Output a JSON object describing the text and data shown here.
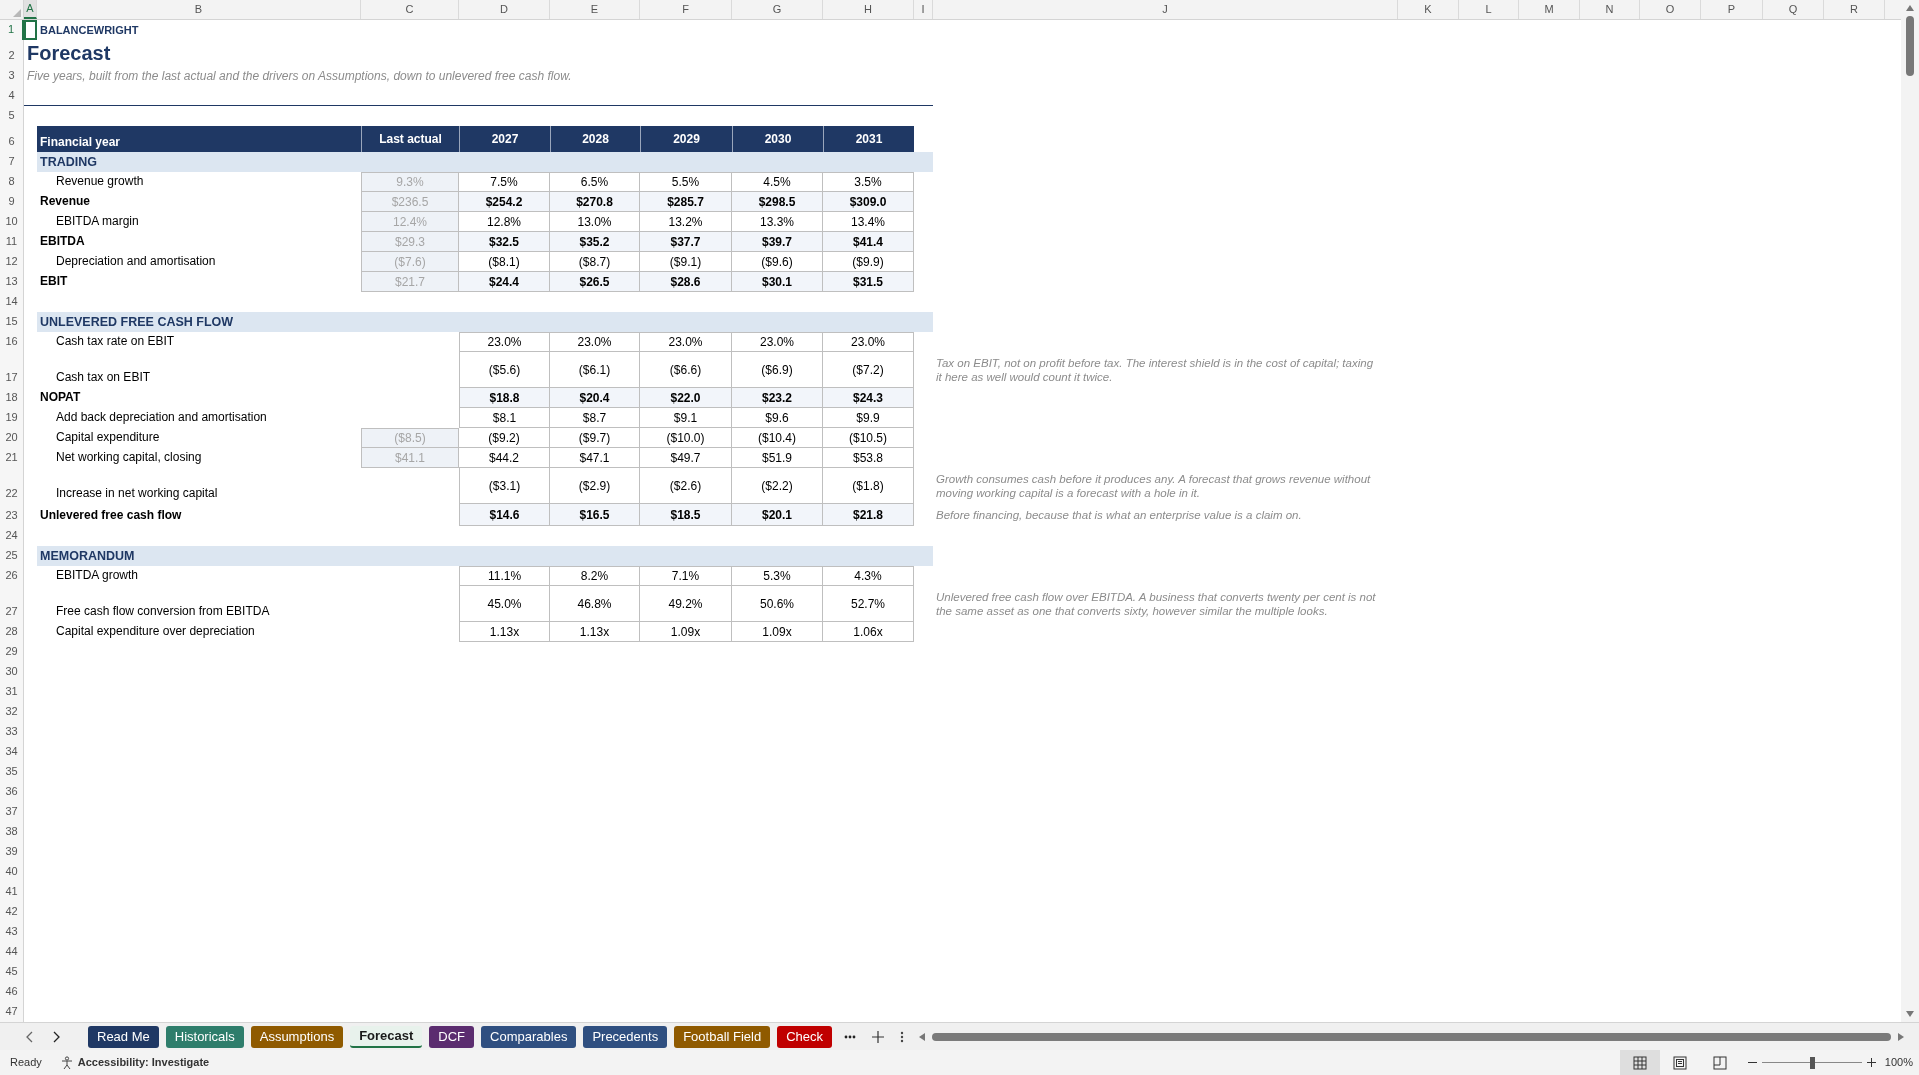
{
  "column_headers": [
    {
      "label": "A",
      "selected": true
    },
    {
      "label": "B",
      "selected": false
    },
    {
      "label": "C",
      "selected": false
    },
    {
      "label": "D",
      "selected": false
    },
    {
      "label": "E",
      "selected": false
    },
    {
      "label": "F",
      "selected": false
    },
    {
      "label": "G",
      "selected": false
    },
    {
      "label": "H",
      "selected": false
    },
    {
      "label": "I",
      "selected": false
    },
    {
      "label": "J",
      "selected": false
    },
    {
      "label": "K",
      "selected": false
    },
    {
      "label": "L",
      "selected": false
    },
    {
      "label": "M",
      "selected": false
    },
    {
      "label": "N",
      "selected": false
    },
    {
      "label": "O",
      "selected": false
    },
    {
      "label": "P",
      "selected": false
    },
    {
      "label": "Q",
      "selected": false
    },
    {
      "label": "R",
      "selected": false
    }
  ],
  "row_headers": [
    {
      "label": "1",
      "selected": true
    },
    {
      "label": "2",
      "selected": false
    },
    {
      "label": "3",
      "selected": false
    },
    {
      "label": "4",
      "selected": false
    },
    {
      "label": "5",
      "selected": false
    },
    {
      "label": "6",
      "selected": false
    },
    {
      "label": "7",
      "selected": false
    },
    {
      "label": "8",
      "selected": false
    },
    {
      "label": "9",
      "selected": false
    },
    {
      "label": "10",
      "selected": false
    },
    {
      "label": "11",
      "selected": false
    },
    {
      "label": "12",
      "selected": false
    },
    {
      "label": "13",
      "selected": false
    },
    {
      "label": "14",
      "selected": false
    },
    {
      "label": "15",
      "selected": false
    },
    {
      "label": "16",
      "selected": false
    },
    {
      "label": "17",
      "selected": false
    },
    {
      "label": "18",
      "selected": false
    },
    {
      "label": "19",
      "selected": false
    },
    {
      "label": "20",
      "selected": false
    },
    {
      "label": "21",
      "selected": false
    },
    {
      "label": "22",
      "selected": false
    },
    {
      "label": "23",
      "selected": false
    },
    {
      "label": "24",
      "selected": false
    },
    {
      "label": "25",
      "selected": false
    },
    {
      "label": "26",
      "selected": false
    },
    {
      "label": "27",
      "selected": false
    },
    {
      "label": "28",
      "selected": false
    },
    {
      "label": "29",
      "selected": false
    },
    {
      "label": "30",
      "selected": false
    },
    {
      "label": "31",
      "selected": false
    },
    {
      "label": "32",
      "selected": false
    },
    {
      "label": "33",
      "selected": false
    },
    {
      "label": "34",
      "selected": false
    },
    {
      "label": "35",
      "selected": false
    },
    {
      "label": "36",
      "selected": false
    },
    {
      "label": "37",
      "selected": false
    },
    {
      "label": "38",
      "selected": false
    },
    {
      "label": "39",
      "selected": false
    },
    {
      "label": "40",
      "selected": false
    },
    {
      "label": "41",
      "selected": false
    },
    {
      "label": "42",
      "selected": false
    },
    {
      "label": "43",
      "selected": false
    },
    {
      "label": "44",
      "selected": false
    },
    {
      "label": "45",
      "selected": false
    },
    {
      "label": "46",
      "selected": false
    },
    {
      "label": "47",
      "selected": false
    }
  ],
  "brand": "BALANCEWRIGHT",
  "title": "Forecast",
  "subtitle": "Five years, built from the last actual and the drivers on Assumptions, down to unlevered free cash flow.",
  "table": {
    "header_label": "Financial year",
    "columns": [
      "Last actual",
      "2027",
      "2028",
      "2029",
      "2030",
      "2031"
    ],
    "sections": [
      {
        "title": "TRADING",
        "rows": [
          {
            "label": "Revenue growth",
            "kind": "line",
            "last_actual": "9.3%",
            "values": [
              "7.5%",
              "6.5%",
              "5.5%",
              "4.5%",
              "3.5%"
            ]
          },
          {
            "label": "Revenue",
            "kind": "total",
            "last_actual": "$236.5",
            "values": [
              "$254.2",
              "$270.8",
              "$285.7",
              "$298.5",
              "$309.0"
            ]
          },
          {
            "label": "EBITDA margin",
            "kind": "line",
            "last_actual": "12.4%",
            "values": [
              "12.8%",
              "13.0%",
              "13.2%",
              "13.3%",
              "13.4%"
            ]
          },
          {
            "label": "EBITDA",
            "kind": "total",
            "last_actual": "$29.3",
            "values": [
              "$32.5",
              "$35.2",
              "$37.7",
              "$39.7",
              "$41.4"
            ]
          },
          {
            "label": "Depreciation and amortisation",
            "kind": "line",
            "last_actual": "($7.6)",
            "values": [
              "($8.1)",
              "($8.7)",
              "($9.1)",
              "($9.6)",
              "($9.9)"
            ]
          },
          {
            "label": "EBIT",
            "kind": "total",
            "last_actual": "$21.7",
            "values": [
              "$24.4",
              "$26.5",
              "$28.6",
              "$30.1",
              "$31.5"
            ]
          }
        ]
      },
      {
        "title": "UNLEVERED FREE CASH FLOW",
        "rows": [
          {
            "label": "Cash tax rate on EBIT",
            "kind": "line",
            "values": [
              "23.0%",
              "23.0%",
              "23.0%",
              "23.0%",
              "23.0%"
            ]
          },
          {
            "label": "Cash tax on EBIT",
            "kind": "line",
            "values": [
              "($5.6)",
              "($6.1)",
              "($6.6)",
              "($6.9)",
              "($7.2)"
            ],
            "note": "Tax on EBIT, not on profit before tax. The interest shield is in the cost of capital; taxing it here as well would count it twice."
          },
          {
            "label": "NOPAT",
            "kind": "total",
            "values": [
              "$18.8",
              "$20.4",
              "$22.0",
              "$23.2",
              "$24.3"
            ]
          },
          {
            "label": "Add back depreciation and amortisation",
            "kind": "line",
            "values": [
              "$8.1",
              "$8.7",
              "$9.1",
              "$9.6",
              "$9.9"
            ]
          },
          {
            "label": "Capital expenditure",
            "kind": "line",
            "last_actual": "($8.5)",
            "values": [
              "($9.2)",
              "($9.7)",
              "($10.0)",
              "($10.4)",
              "($10.5)"
            ]
          },
          {
            "label": "Net working capital, closing",
            "kind": "line",
            "last_actual": "$41.1",
            "values": [
              "$44.2",
              "$47.1",
              "$49.7",
              "$51.9",
              "$53.8"
            ]
          },
          {
            "label": "Increase in net working capital",
            "kind": "line",
            "values": [
              "($3.1)",
              "($2.9)",
              "($2.6)",
              "($2.2)",
              "($1.8)"
            ],
            "note": "Growth consumes cash before it produces any. A forecast that grows revenue without moving working capital is a forecast with a hole in it."
          },
          {
            "label": "Unlevered free cash flow",
            "kind": "total",
            "values": [
              "$14.6",
              "$16.5",
              "$18.5",
              "$20.1",
              "$21.8"
            ],
            "note": "Before financing, because that is what an enterprise value is a claim on."
          }
        ]
      },
      {
        "title": "MEMORANDUM",
        "rows": [
          {
            "label": "EBITDA growth",
            "kind": "line",
            "values": [
              "11.1%",
              "8.2%",
              "7.1%",
              "5.3%",
              "4.3%"
            ]
          },
          {
            "label": "Free cash flow conversion from EBITDA",
            "kind": "line",
            "values": [
              "45.0%",
              "46.8%",
              "49.2%",
              "50.6%",
              "52.7%"
            ],
            "note": "Unlevered free cash flow over EBITDA. A business that converts twenty per cent is not the same asset as one that converts sixty, however similar the multiple looks."
          },
          {
            "label": "Capital expenditure over depreciation",
            "kind": "line",
            "values": [
              "1.13x",
              "1.13x",
              "1.09x",
              "1.09x",
              "1.06x"
            ]
          }
        ]
      }
    ]
  },
  "sheet_tabs": [
    {
      "label": "Read Me",
      "color": "#1f3864",
      "selected": false
    },
    {
      "label": "Historicals",
      "color": "#2e7d6b",
      "selected": false
    },
    {
      "label": "Assumptions",
      "color": "#8f5a00",
      "selected": false
    },
    {
      "label": "Forecast",
      "color": "#217346",
      "selected": true
    },
    {
      "label": "DCF",
      "color": "#5b2c6f",
      "selected": false
    },
    {
      "label": "Comparables",
      "color": "#2f4f80",
      "selected": false
    },
    {
      "label": "Precedents",
      "color": "#2f4f80",
      "selected": false
    },
    {
      "label": "Football Field",
      "color": "#8f5a00",
      "selected": false
    },
    {
      "label": "Check",
      "color": "#c00000",
      "selected": false
    }
  ],
  "status_bar": {
    "mode": "Ready",
    "accessibility": "Accessibility: Investigate",
    "views": [
      {
        "kind": "normal",
        "selected": true
      },
      {
        "kind": "page_layout",
        "selected": false
      },
      {
        "kind": "page_break_preview",
        "selected": false
      }
    ],
    "zoom": {
      "level": 0.5,
      "reading": "100%"
    }
  }
}
